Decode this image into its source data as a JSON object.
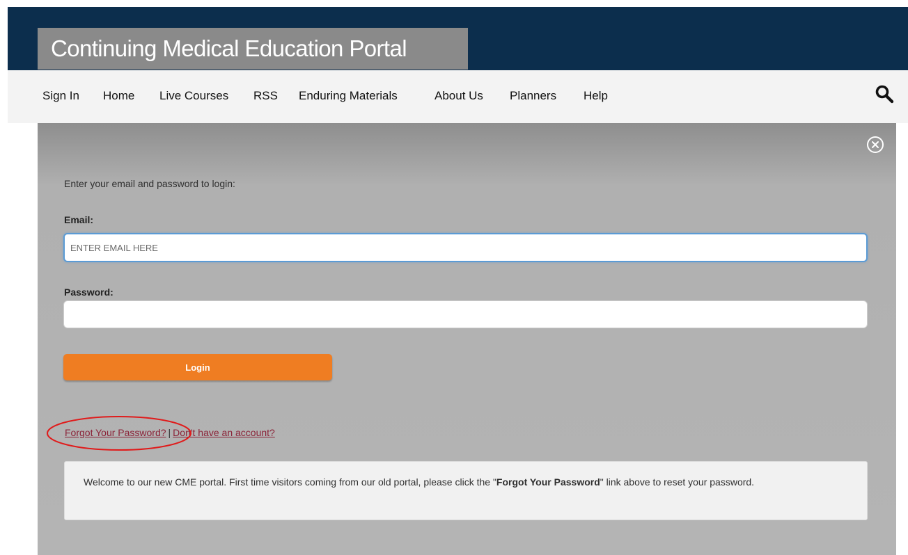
{
  "header": {
    "title": "Continuing Medical Education Portal"
  },
  "nav": {
    "items": [
      {
        "label": "Sign In"
      },
      {
        "label": "Home"
      },
      {
        "label": "Live Courses"
      },
      {
        "label": "RSS"
      },
      {
        "label": "Enduring Materials"
      },
      {
        "label": "About Us"
      },
      {
        "label": "Planners"
      },
      {
        "label": "Help"
      }
    ],
    "search_icon": "search-icon"
  },
  "login": {
    "close_icon": "close-icon",
    "intro": "Enter your email and password to login:",
    "email_label": "Email:",
    "email_placeholder": "ENTER EMAIL HERE",
    "email_value": "",
    "password_label": "Password:",
    "password_value": "",
    "login_button": "Login",
    "forgot_link": "Forgot Your Password?",
    "separator": "|",
    "signup_link": "Don't have an account?"
  },
  "notice": {
    "before": "Welcome to our new CME portal.  First time visitors coming from our old portal, please click the \"",
    "bold": "Forgot Your Password",
    "after": "\" link above to reset your password."
  },
  "colors": {
    "header_bg": "#0c2e4d",
    "title_bg": "#8a8a8a",
    "login_button": "#ef7d22",
    "link": "#8b2338",
    "annotation": "#e01b1b"
  }
}
